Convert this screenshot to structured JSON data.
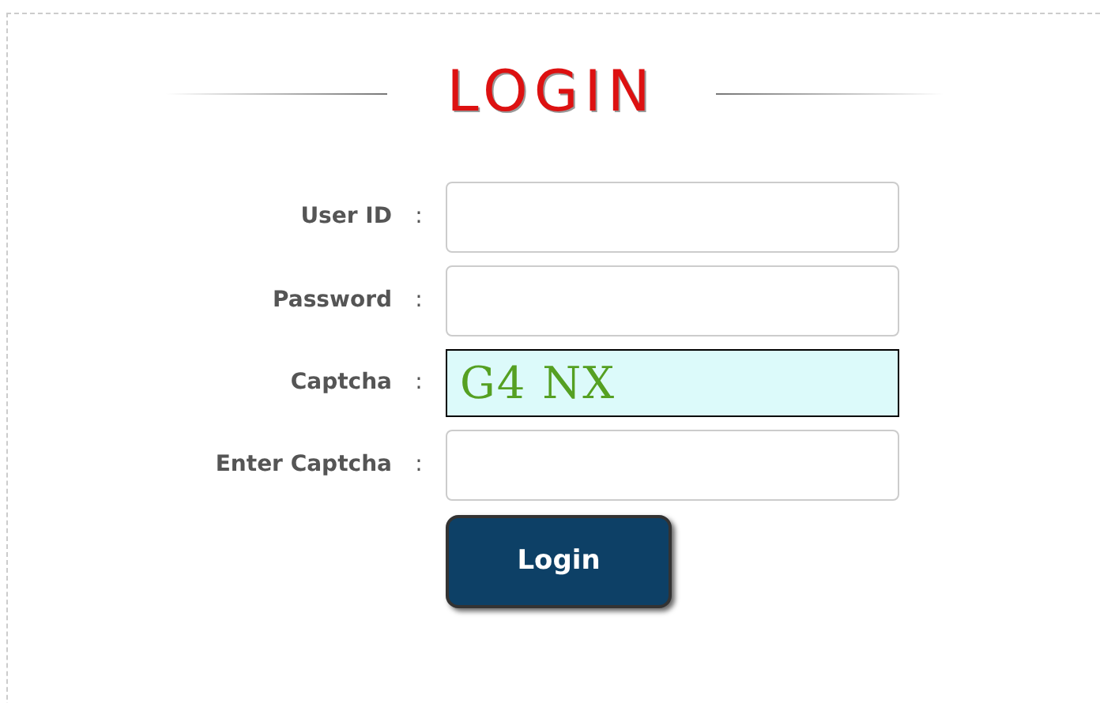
{
  "title": "LOGIN",
  "fields": [
    {
      "kind": "input",
      "label": "User ID",
      "separator": ":"
    },
    {
      "kind": "input",
      "label": "Password",
      "separator": ":"
    },
    {
      "kind": "captcha",
      "label": "Captcha",
      "separator": ":",
      "value": "G4 NX"
    },
    {
      "kind": "input",
      "label": "Enter Captcha",
      "separator": ":"
    }
  ],
  "button": "Login"
}
